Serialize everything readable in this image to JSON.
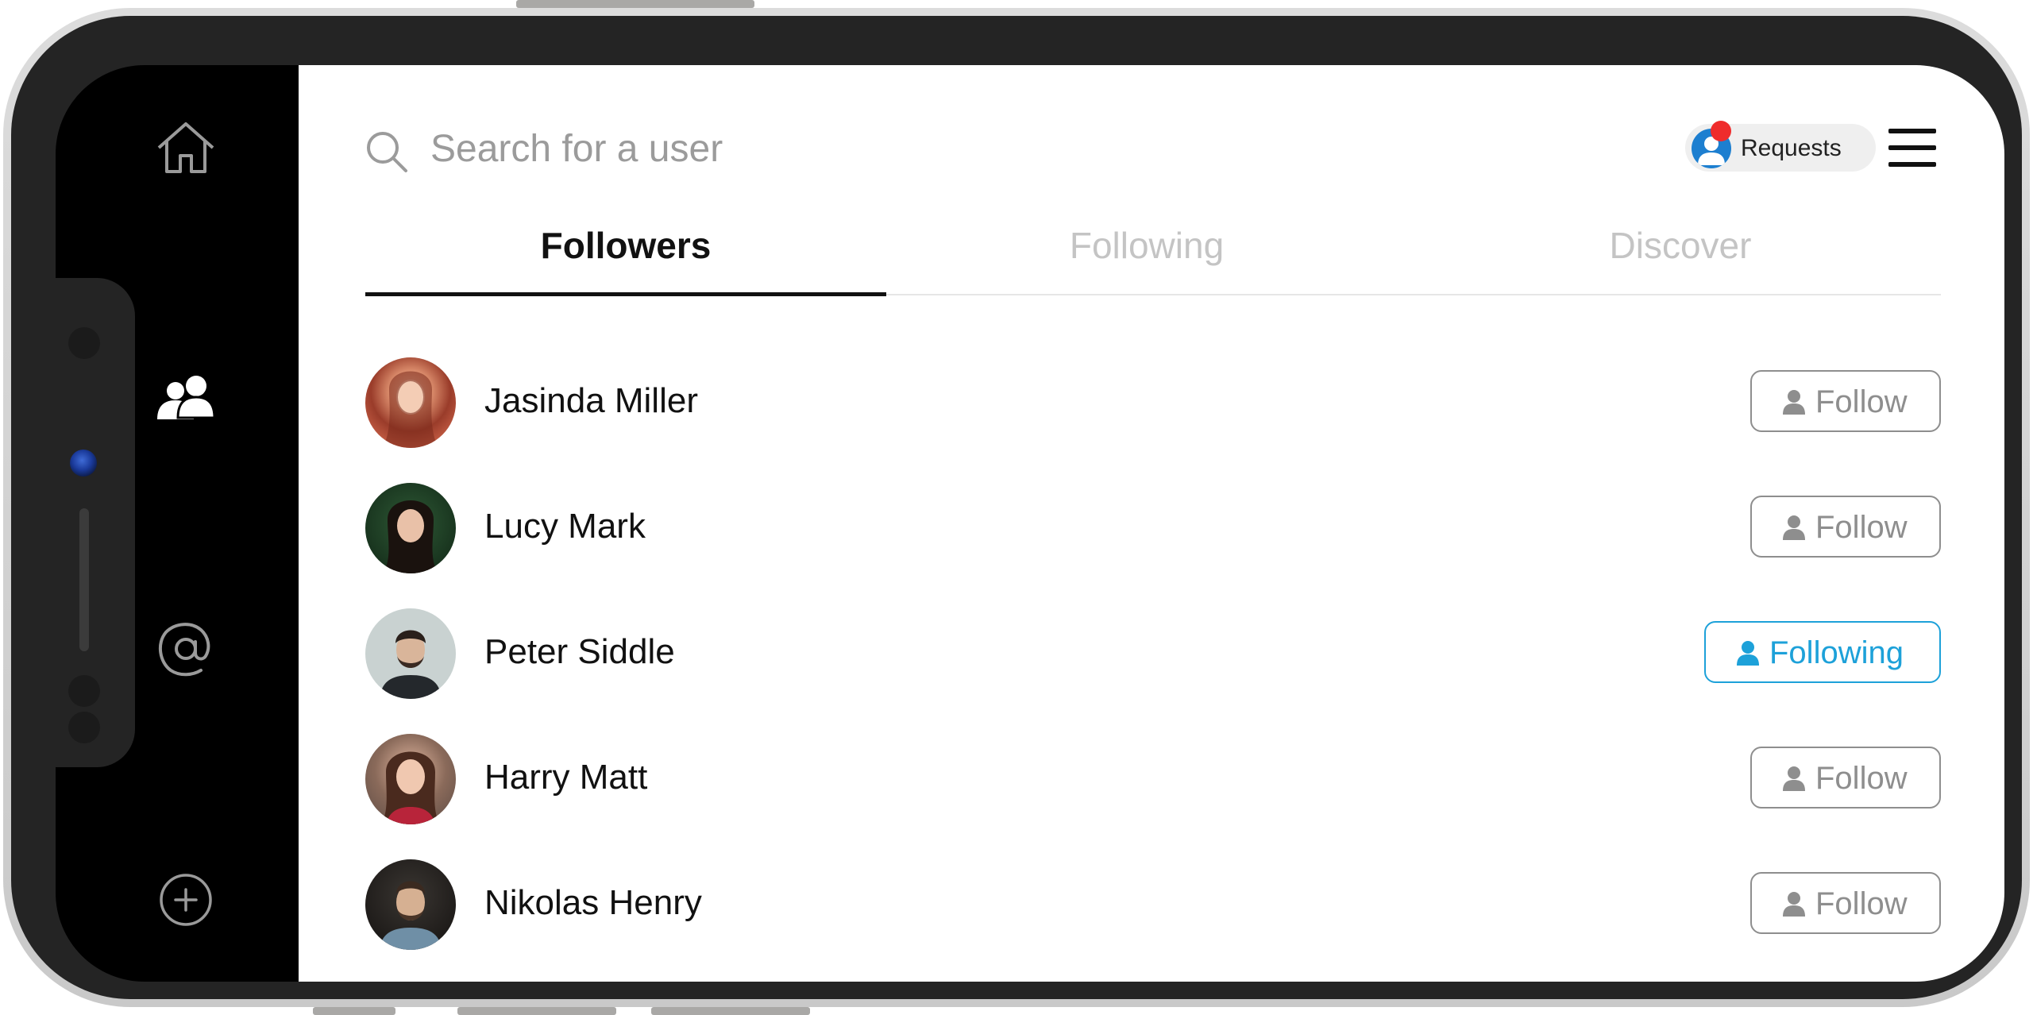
{
  "sidebar": {
    "items": [
      {
        "name": "home",
        "icon": "home-icon"
      },
      {
        "name": "people",
        "icon": "users-icon",
        "active": true
      },
      {
        "name": "mentions",
        "icon": "at-icon"
      },
      {
        "name": "add",
        "icon": "add-circle-icon"
      }
    ]
  },
  "search": {
    "placeholder": "Search for a user"
  },
  "requests": {
    "label": "Requests",
    "has_notification": true
  },
  "tabs": [
    {
      "label": "Followers",
      "active": true
    },
    {
      "label": "Following",
      "active": false
    },
    {
      "label": "Discover",
      "active": false
    }
  ],
  "users": [
    {
      "name": "Jasinda Miller",
      "button": "Follow",
      "following": false
    },
    {
      "name": "Lucy Mark",
      "button": "Follow",
      "following": false
    },
    {
      "name": "Peter Siddle",
      "button": "Following",
      "following": true
    },
    {
      "name": "Harry Matt",
      "button": "Follow",
      "following": false
    },
    {
      "name": "Nikolas Henry",
      "button": "Follow",
      "following": false
    }
  ],
  "colors": {
    "accent": "#1da1d9",
    "notification": "#ef2c2c",
    "sidebar": "#000000",
    "muted": "#8e8e8e"
  }
}
